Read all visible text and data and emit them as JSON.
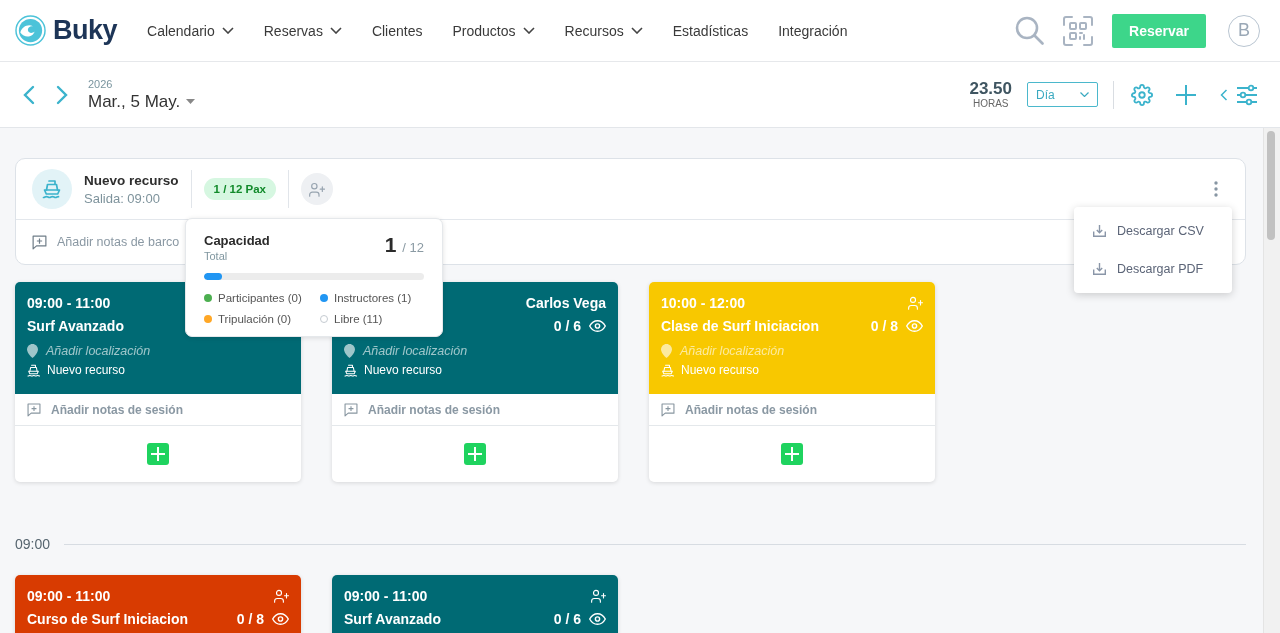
{
  "header": {
    "logo_text": "Buky",
    "nav": [
      {
        "label": "Calendario",
        "has_menu": true
      },
      {
        "label": "Reservas",
        "has_menu": true
      },
      {
        "label": "Clientes",
        "has_menu": false
      },
      {
        "label": "Productos",
        "has_menu": true
      },
      {
        "label": "Recursos",
        "has_menu": true
      },
      {
        "label": "Estadísticas",
        "has_menu": false
      },
      {
        "label": "Integración",
        "has_menu": false
      }
    ],
    "reserve_button": "Reservar",
    "avatar": "B"
  },
  "toolbar": {
    "year": "2026",
    "date": "Mar., 5 May.",
    "hours_value": "23.50",
    "hours_label": "HORAS",
    "view_select": {
      "value": "Día"
    }
  },
  "resource": {
    "name": "Nuevo recurso",
    "departure": "Salida: 09:00",
    "pax": "1 / 12 Pax",
    "add_notes": "Añadir notas de barco"
  },
  "capacity_popover": {
    "title": "Capacidad",
    "subtitle": "Total",
    "count": "1",
    "total": "/ 12",
    "level": 0.083,
    "legend": [
      {
        "label": "Participantes (0)",
        "kind": "filled",
        "color": "#4caf50"
      },
      {
        "label": "Instructores (1)",
        "kind": "filled",
        "color": "#2196f3"
      },
      {
        "label": "Tripulación (0)",
        "kind": "filled",
        "color": "#ffa726"
      },
      {
        "label": "Libre (11)",
        "kind": "hollow",
        "color": "#c5cbd1"
      }
    ]
  },
  "export_menu": {
    "items": [
      {
        "label": "Descargar CSV"
      },
      {
        "label": "Descargar PDF"
      }
    ]
  },
  "sessions": [
    {
      "color": "#006a74",
      "time": "09:00 - 11:00",
      "title": "Surf Avanzado",
      "add_location": "Añadir localización",
      "resource": "Nuevo recurso",
      "add_notes": "Añadir notas de sesión"
    },
    {
      "color": "#006a74",
      "instructor": "Carlos Vega",
      "count": "0 / 6",
      "add_location": "Añadir localización",
      "resource": "Nuevo recurso",
      "add_notes": "Añadir notas de sesión"
    },
    {
      "color": "#f8c800",
      "time": "10:00 - 12:00",
      "title": "Clase de Surf Iniciacion",
      "count": "0 / 8",
      "add_location": "Añadir localización",
      "resource": "Nuevo recurso",
      "add_notes": "Añadir notas de sesión"
    }
  ],
  "timeline": [
    {
      "time": "09:00",
      "sessions": [
        {
          "color": "#d83b01",
          "time": "09:00 - 11:00",
          "title": "Curso de Surf Iniciacion",
          "count": "0 / 8"
        },
        {
          "color": "#006a74",
          "time": "09:00 - 11:00",
          "title": "Surf Avanzado",
          "count": "0 / 6"
        }
      ]
    }
  ]
}
